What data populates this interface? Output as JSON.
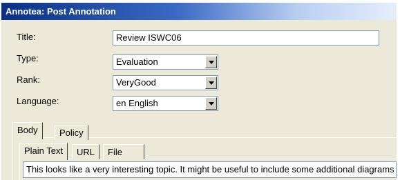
{
  "window": {
    "title": "Annotea: Post Annotation"
  },
  "form": {
    "title_label": "Title:",
    "title_value": "Review ISWC06",
    "type_label": "Type:",
    "type_value": "Evaluation",
    "rank_label": "Rank:",
    "rank_value": "VeryGood",
    "language_label": "Language:",
    "language_value": "en English"
  },
  "tabs": {
    "outer": [
      "Body",
      "Policy"
    ],
    "inner": [
      "Plain Text",
      "URL",
      "File"
    ]
  },
  "body": {
    "text": "This looks like a very interesting topic. It might be useful to include some additional diagrams"
  },
  "colors": {
    "titlebar_start": "#0a2f85",
    "panel_bg": "#ece9d8",
    "input_border": "#7f9db9"
  },
  "icons": {
    "dropdown": "chevron-down-icon"
  }
}
